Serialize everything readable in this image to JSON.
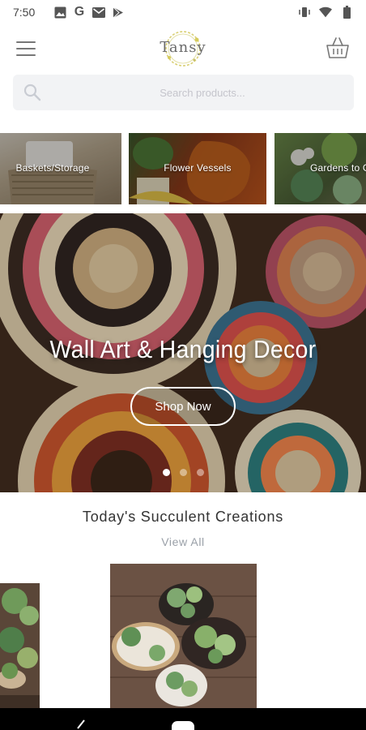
{
  "status_bar": {
    "time": "7:50",
    "notification_icons": [
      "photos-icon",
      "google-icon",
      "mail-icon",
      "play-store-icon"
    ],
    "google_letter": "G",
    "system_icons": [
      "vibrate-icon",
      "wifi-icon",
      "battery-icon"
    ]
  },
  "header": {
    "logo_text": "Tansy",
    "menu_icon": "hamburger-menu-icon",
    "cart_icon": "basket-icon"
  },
  "search": {
    "placeholder": "Search products...",
    "value": ""
  },
  "categories": [
    {
      "label": "Baskets/Storage"
    },
    {
      "label": "Flower Vessels"
    },
    {
      "label": "Gardens to Go"
    }
  ],
  "hero": {
    "title": "Wall Art & Hanging Decor",
    "button_label": "Shop Now",
    "slide_count": 3,
    "active_slide": 1
  },
  "section": {
    "title": "Today's Succulent Creations",
    "view_all": "View All"
  },
  "colors": {
    "accent": "#9aa0a8",
    "search_bg": "#f2f3f5",
    "hero_bg": "#3b2a20"
  }
}
